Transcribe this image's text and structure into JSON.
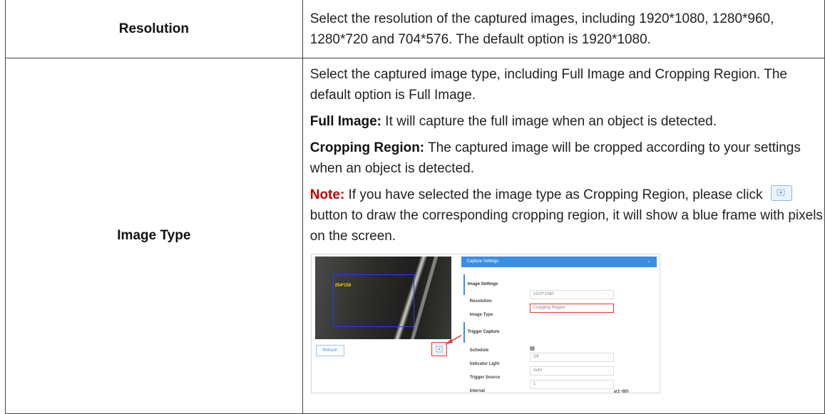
{
  "rows": [
    {
      "label": "Resolution",
      "description": "Select the resolution of the captured images, including 1920*1080, 1280*960, 1280*720 and 704*576. The default option is 1920*1080."
    },
    {
      "label": "Image Type",
      "intro": "Select the captured image type, including Full Image and Cropping Region. The default option is Full Image.",
      "full_image_term": "Full Image:",
      "full_image_text": " It will capture the full image when an object is detected.",
      "cropping_term": "Cropping Region:",
      "cropping_text": " The captured image will be cropped according to your settings when an object is detected.",
      "note_term": "Note:",
      "note_text_before": " If you have selected the image type as Cropping Region, please click ",
      "note_icon": "crop-region-icon",
      "note_text_after": " button to draw the corresponding cropping region, it will show a blue frame with pixels on the screen."
    }
  ],
  "screenshot": {
    "pixel_label": "254*159",
    "refresh_label": "Refresh",
    "panel_title": "Capture Settings",
    "image_settings_title": "Image Settings",
    "resolution_label": "Resolution",
    "resolution_value": "1920*1080",
    "image_type_label": "Image Type",
    "image_type_value": "Cropping Region",
    "trigger_capture_title": "Trigger Capture",
    "schedule_label": "Schedule",
    "indicator_light_label": "Indicator Light",
    "indicator_light_value": "Off",
    "trigger_source_label": "Trigger Source",
    "trigger_source_value": "Auto",
    "interval_label": "Interval",
    "interval_value": "1",
    "interval_unit": "s(1~60)",
    "colors": {
      "accent": "#3a8ee6",
      "highlight": "#e53935",
      "frame": "#2a3df0",
      "note": "#c00000"
    }
  }
}
